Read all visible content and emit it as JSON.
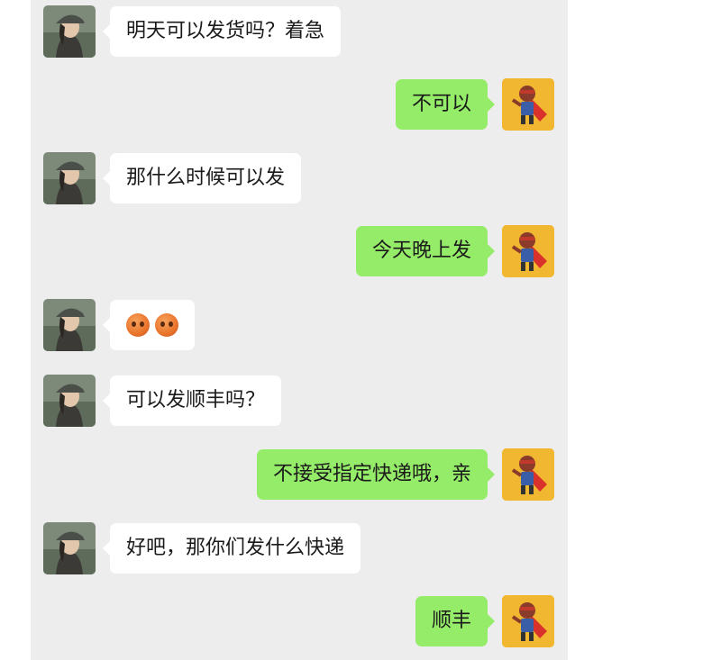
{
  "messages": [
    {
      "side": "her",
      "text": "明天可以发货吗？着急"
    },
    {
      "side": "me",
      "text": "不可以"
    },
    {
      "side": "her",
      "text": "那什么时候可以发"
    },
    {
      "side": "me",
      "text": "今天晚上发"
    },
    {
      "side": "her",
      "text": "",
      "emoji": [
        "worried-face-emoji",
        "worried-face-emoji"
      ]
    },
    {
      "side": "her",
      "text": "可以发顺丰吗？"
    },
    {
      "side": "me",
      "text": "不接受指定快递哦，亲"
    },
    {
      "side": "her",
      "text": "好吧，那你们发什么快递"
    },
    {
      "side": "me",
      "text": "顺丰"
    }
  ],
  "colors": {
    "chat_bg": "#ededed",
    "her_bubble": "#ffffff",
    "me_bubble": "#95ec69",
    "me_avatar_bg": "#f2b731"
  },
  "icons": {
    "her_avatar": "woman-in-cap-avatar",
    "me_avatar": "superhero-cartoon-avatar"
  }
}
